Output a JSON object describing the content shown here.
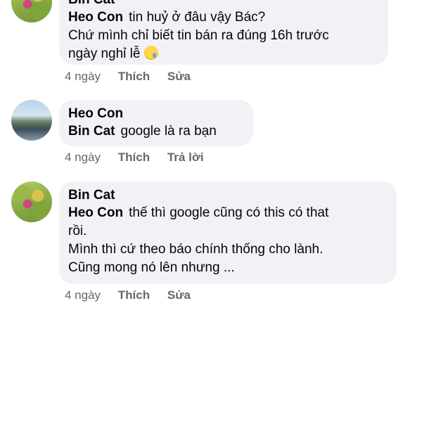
{
  "comments": [
    {
      "author": "Bin Cat",
      "mention": "Heo Con",
      "text_first": "tin huỷ ở đâu vậy Bác?",
      "text_lines": [
        "Chứ mình chỉ biết tin bán ra đúng 16h trước",
        "ngày nghỉ lễ"
      ],
      "emoji": "crying-face",
      "time": "4 ngày",
      "like_label": "Thích",
      "action_label": "Sửa"
    },
    {
      "author": "Heo Con",
      "mention": "Bin Cat",
      "text_first": "google là ra bạn",
      "time": "4 ngày",
      "like_label": "Thích",
      "action_label": "Trả lời"
    },
    {
      "author": "Bin Cat",
      "mention": "Heo Con",
      "text_first": "thế thì google cũng có this có that",
      "text_lines": [
        "rồi.",
        "Mình thì cứ theo báo chính thống cho lành.",
        "Cũng mong nó lên nhưng ..."
      ],
      "time": "4 ngày",
      "like_label": "Thích",
      "action_label": "Sửa"
    }
  ]
}
